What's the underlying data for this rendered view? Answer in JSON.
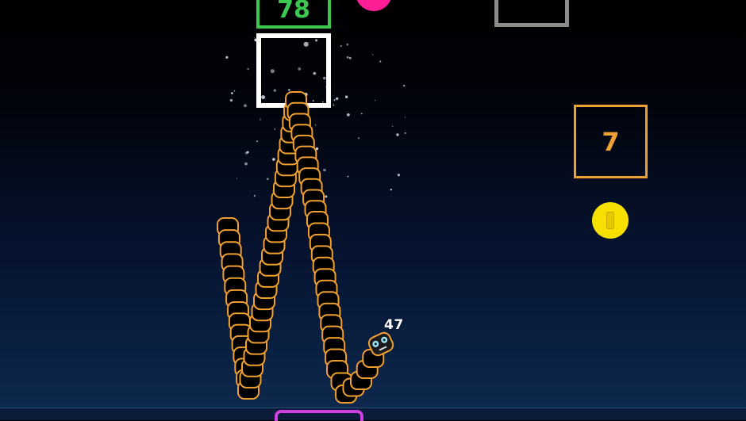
{
  "game": {
    "snake_length": "47",
    "colors": {
      "snake_outline": "#f0a030",
      "snake_fill": "#000000",
      "block_green": "#3cc850",
      "block_white": "#ffffff",
      "block_gray": "#8c8c8c",
      "block_orange": "#f0a030",
      "coin": "#f5e000",
      "magenta": "#ff1e96"
    }
  },
  "blocks": [
    {
      "id": "green",
      "label": "78"
    },
    {
      "id": "white",
      "label": ""
    },
    {
      "id": "gray",
      "label": ""
    },
    {
      "id": "orange",
      "label": "7"
    }
  ],
  "bottom_pad": {
    "color": "#d040e0"
  }
}
